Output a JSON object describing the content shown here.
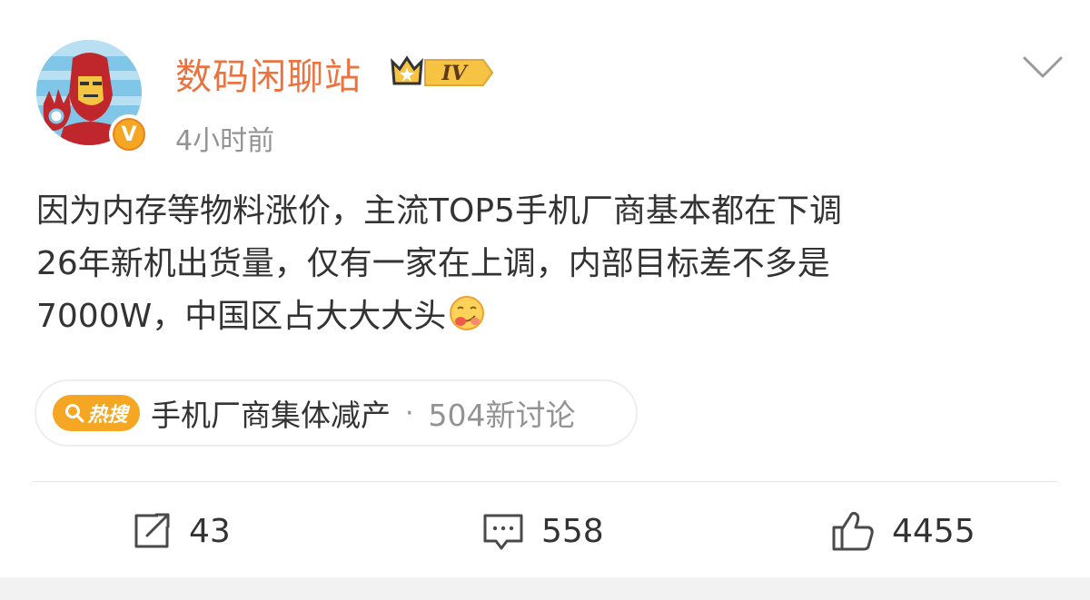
{
  "post": {
    "author": {
      "name": "数码闲聊站",
      "level_badge": "IV",
      "verified_badge": "V"
    },
    "timestamp": "4小时前",
    "content_lines": [
      "因为内存等物料涨价，主流TOP5手机厂商基本都在下调",
      "26年新机出货量，仅有一家在上调，内部目标差不多是",
      "7000W，中国区占大大大头"
    ],
    "emoji": "drooling-face-emoji"
  },
  "hot_search": {
    "tag": "热搜",
    "title": "手机厂商集体减产",
    "separator": "·",
    "discussion": "504新讨论"
  },
  "actions": {
    "repost_count": "43",
    "comment_count": "558",
    "like_count": "4455"
  },
  "icons": {
    "more": "chevron-down-icon",
    "repost": "repost-icon",
    "comment": "comment-icon",
    "like": "thumbs-up-icon",
    "search": "search-icon"
  },
  "colors": {
    "username": "#eb7340",
    "muted": "#939393",
    "text": "#333333",
    "hot_tag": "#f5a623",
    "verified": "#f5a623"
  }
}
